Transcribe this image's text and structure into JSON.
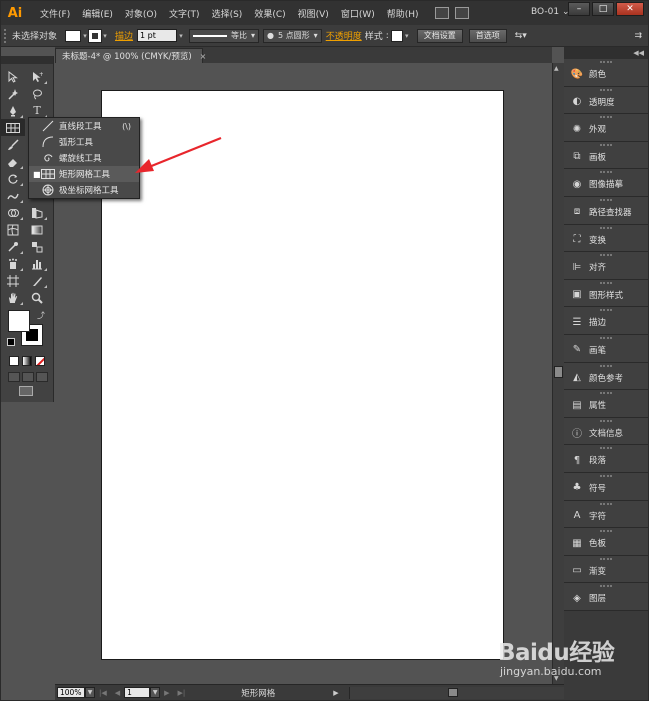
{
  "app": {
    "logo": "Ai",
    "workspace": "BO-01",
    "workspace_arrow": "⌄"
  },
  "menu": [
    "文件(F)",
    "编辑(E)",
    "对象(O)",
    "文字(T)",
    "选择(S)",
    "效果(C)",
    "视图(V)",
    "窗口(W)",
    "帮助(H)"
  ],
  "window_controls": {
    "minimize": "–",
    "maximize": "□",
    "close": "✕"
  },
  "control_bar": {
    "selection": "未选择对象",
    "stroke_label": "描边",
    "stroke_weight": "1 pt",
    "profile": "等比",
    "brush": "5 点圆形",
    "opacity_label": "不透明度",
    "style_label": "样式",
    "doc_setup": "文档设置",
    "preferences": "首选项"
  },
  "document": {
    "tab_title": "未标题-4* @ 100% (CMYK/预览)",
    "tab_close": "×"
  },
  "flyout": {
    "items": [
      {
        "label": "直线段工具",
        "shortcut": "(\\)",
        "icon": "line-segment-icon",
        "selected": false
      },
      {
        "label": "弧形工具",
        "shortcut": "",
        "icon": "arc-icon",
        "selected": false
      },
      {
        "label": "螺旋线工具",
        "shortcut": "",
        "icon": "spiral-icon",
        "selected": false
      },
      {
        "label": "矩形网格工具",
        "shortcut": "",
        "icon": "rectangular-grid-icon",
        "selected": true
      },
      {
        "label": "极坐标网格工具",
        "shortcut": "",
        "icon": "polar-grid-icon",
        "selected": false
      }
    ],
    "bullet": "■"
  },
  "status_bar": {
    "zoom": "100%",
    "page": "1",
    "status_text": "矩形网格"
  },
  "panels": [
    {
      "label": "颜色",
      "icon": "color-icon"
    },
    {
      "label": "透明度",
      "icon": "transparency-icon"
    },
    {
      "label": "外观",
      "icon": "appearance-icon"
    },
    {
      "label": "画板",
      "icon": "artboards-icon"
    },
    {
      "label": "图像描摹",
      "icon": "image-trace-icon"
    },
    {
      "label": "路径查找器",
      "icon": "pathfinder-icon"
    },
    {
      "label": "变换",
      "icon": "transform-icon"
    },
    {
      "label": "对齐",
      "icon": "align-icon"
    },
    {
      "label": "图形样式",
      "icon": "graphic-styles-icon"
    },
    {
      "label": "描边",
      "icon": "stroke-icon"
    },
    {
      "label": "画笔",
      "icon": "brushes-icon"
    },
    {
      "label": "颜色参考",
      "icon": "color-guide-icon"
    },
    {
      "label": "属性",
      "icon": "attributes-icon"
    },
    {
      "label": "文档信息",
      "icon": "document-info-icon"
    },
    {
      "label": "段落",
      "icon": "paragraph-icon"
    },
    {
      "label": "符号",
      "icon": "symbols-icon"
    },
    {
      "label": "字符",
      "icon": "character-icon"
    },
    {
      "label": "色板",
      "icon": "swatches-icon"
    },
    {
      "label": "渐变",
      "icon": "gradient-icon"
    },
    {
      "label": "图层",
      "icon": "layers-icon"
    }
  ],
  "watermark": {
    "logo": "Baidu经验",
    "url": "jingyan.baidu.com"
  },
  "colors": {
    "accent_arrow": "#e8262c",
    "app_logo": "#ff9a00",
    "label_orange": "#f0a000"
  }
}
